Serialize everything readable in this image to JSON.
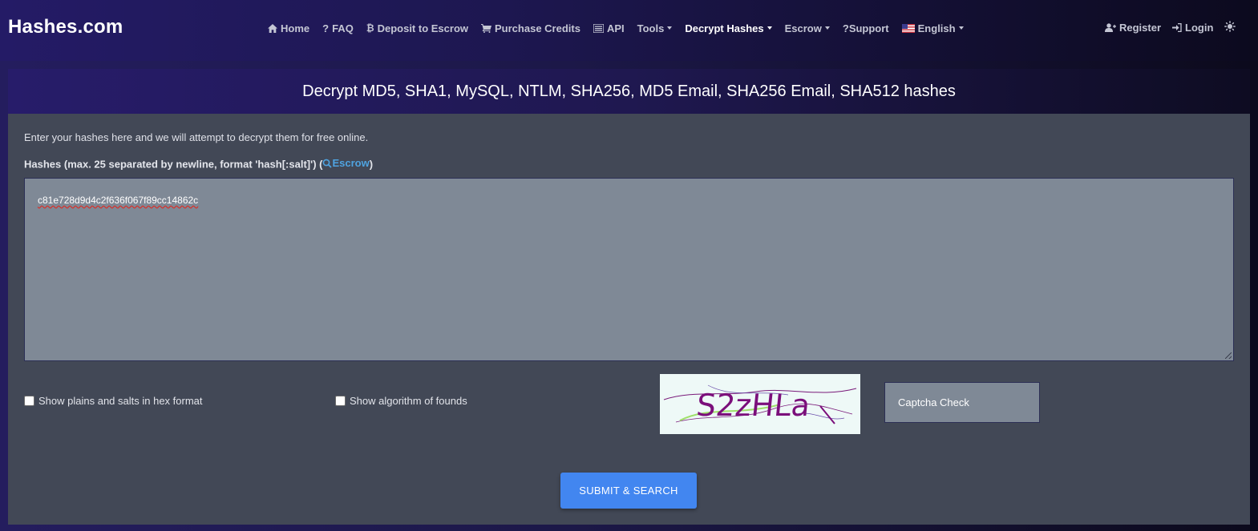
{
  "brand": "Hashes.com",
  "nav": {
    "items": [
      {
        "icon": "home-icon",
        "label": "Home"
      },
      {
        "icon": "question-icon",
        "label": "FAQ"
      },
      {
        "icon": "bitcoin-icon",
        "label": "Deposit to Escrow"
      },
      {
        "icon": "cart-icon",
        "label": "Purchase Credits"
      },
      {
        "icon": "list-icon",
        "label": "API"
      },
      {
        "icon": "",
        "label": "Tools"
      },
      {
        "icon": "",
        "label": "Decrypt Hashes"
      },
      {
        "icon": "",
        "label": "Escrow"
      },
      {
        "icon": "question-icon",
        "label": "Support"
      },
      {
        "icon": "us-flag-icon",
        "label": "English"
      }
    ],
    "active": "Decrypt Hashes",
    "right": [
      {
        "icon": "user-plus-icon",
        "label": "Register"
      },
      {
        "icon": "login-icon",
        "label": "Login"
      },
      {
        "icon": "sun-icon",
        "label": ""
      }
    ]
  },
  "panel": {
    "title": "Decrypt MD5, SHA1, MySQL, NTLM, SHA256, MD5 Email, SHA256 Email, SHA512 hashes",
    "intro": "Enter your hashes here and we will attempt to decrypt them for free online.",
    "hash_label": "Hashes (max. 25 separated by newline, format 'hash[:salt]') (",
    "escrow_link": "Escrow",
    "hash_label_close": ")",
    "hash_value": "c81e728d9d4c2f636f067f89cc14862c",
    "checkbox_hex": "Show plains and salts in hex format",
    "checkbox_algo": "Show algorithm of founds",
    "captcha_text": "S2zHLa",
    "captcha_placeholder": "Captcha Check",
    "submit_label": "SUBMIT & SEARCH"
  },
  "colors": {
    "accent": "#4286f0",
    "link": "#4fa3e0",
    "panel_bg": "#424856",
    "input_bg": "#7f8996"
  }
}
